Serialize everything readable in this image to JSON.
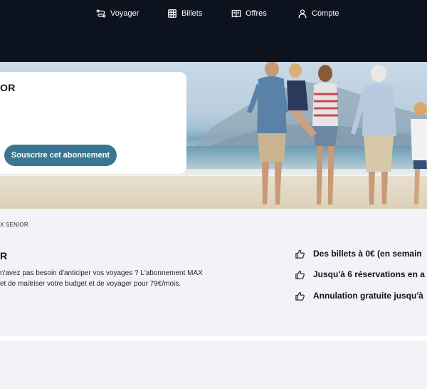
{
  "nav": {
    "items": [
      {
        "label": "Voyager",
        "icon": "route-icon"
      },
      {
        "label": "Billets",
        "icon": "grid-tickets-icon"
      },
      {
        "label": "Offres",
        "icon": "book-icon"
      },
      {
        "label": "Compte",
        "icon": "user-icon"
      }
    ]
  },
  "hero": {
    "title": "OR",
    "cta_label": "Souscrire cet abonnement"
  },
  "breadcrumb": "X SENIOR",
  "main": {
    "title": "R",
    "description_line1": "n'avez pas besoin d'anticiper vos voyages ? L'abonnement MAX",
    "description_line2": "et de maitriser votre budget et de voyager pour 79€/mois.",
    "benefits": [
      {
        "label": "Des billets à 0€ (en semain",
        "icon": "thumbs-up-icon"
      },
      {
        "label": "Jusqu'à 6 réservations en a",
        "icon": "thumbs-up-icon"
      },
      {
        "label": "Annulation gratuite jusqu'à",
        "icon": "thumbs-up-icon"
      }
    ]
  },
  "colors": {
    "header_bg": "#0c131f",
    "cta_bg": "#3a7691",
    "page_bg": "#f3f2f7"
  }
}
